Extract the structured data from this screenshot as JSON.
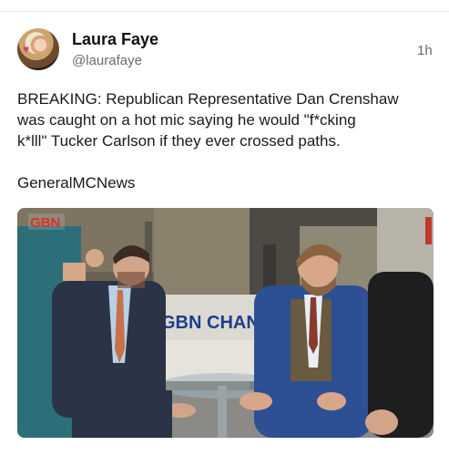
{
  "post": {
    "author_name": "Laura Faye",
    "author_handle": "@laurafaye",
    "timestamp": "1h",
    "body_line1": "BREAKING: Republican Representative Dan Crenshaw",
    "body_line2": "was caught on a hot mic saying he would \"f*cking",
    "body_line3": "k*lll\" Tucker Carlson if they ever crossed paths.",
    "source": "GeneralMCNews"
  },
  "media": {
    "channel_logo": "GBN",
    "backdrop_text": "GBN CHANGE"
  },
  "colors": {
    "gbn_red": "#d9342b",
    "gbn_blue": "#1d3e8a"
  }
}
